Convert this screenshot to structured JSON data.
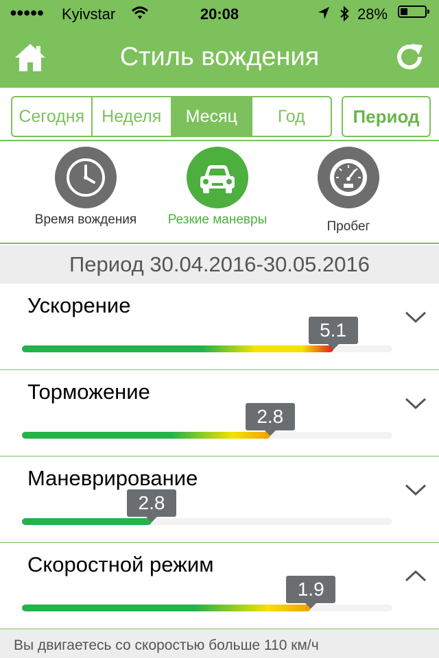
{
  "status_bar": {
    "signal": "●●●●●",
    "carrier": "Kyivstar",
    "time": "20:08",
    "battery_percent": "28%",
    "battery_level": 0.28
  },
  "nav": {
    "title": "Стиль вождения",
    "home_icon": "home-icon",
    "refresh_icon": "refresh-icon"
  },
  "tabs": [
    {
      "label": "Сегодня",
      "active": false
    },
    {
      "label": "Неделя",
      "active": false
    },
    {
      "label": "Месяц",
      "active": true
    },
    {
      "label": "Год",
      "active": false
    }
  ],
  "period_button": "Период",
  "categories": [
    {
      "label": "Время вождения",
      "icon": "clock-icon",
      "active": false
    },
    {
      "label": "Резкие маневры",
      "icon": "car-icon",
      "active": true
    },
    {
      "label": "Пробег",
      "icon": "speedometer-icon",
      "active": false
    }
  ],
  "period_label": "Период 30.04.2016-30.05.2016",
  "metrics": [
    {
      "title": "Ускорение",
      "value": "5.1",
      "level": 0.84,
      "expanded": false
    },
    {
      "title": "Торможение",
      "value": "2.8",
      "level": 0.67,
      "expanded": false
    },
    {
      "title": "Маневрирование",
      "value": "2.8",
      "level": 0.35,
      "expanded": false
    },
    {
      "title": "Скоростной режим",
      "value": "1.9",
      "level": 0.78,
      "expanded": true
    }
  ],
  "colors": {
    "brand_green": "#7cc15b",
    "active_green": "#4caf3e",
    "bar_green": "#22b34a",
    "bar_yellow": "#f5e200",
    "bar_red": "#e02020",
    "bubble_gray": "#6b6e70"
  },
  "description": "Вы двигаетесь со скоростью больше 110 км/ч"
}
